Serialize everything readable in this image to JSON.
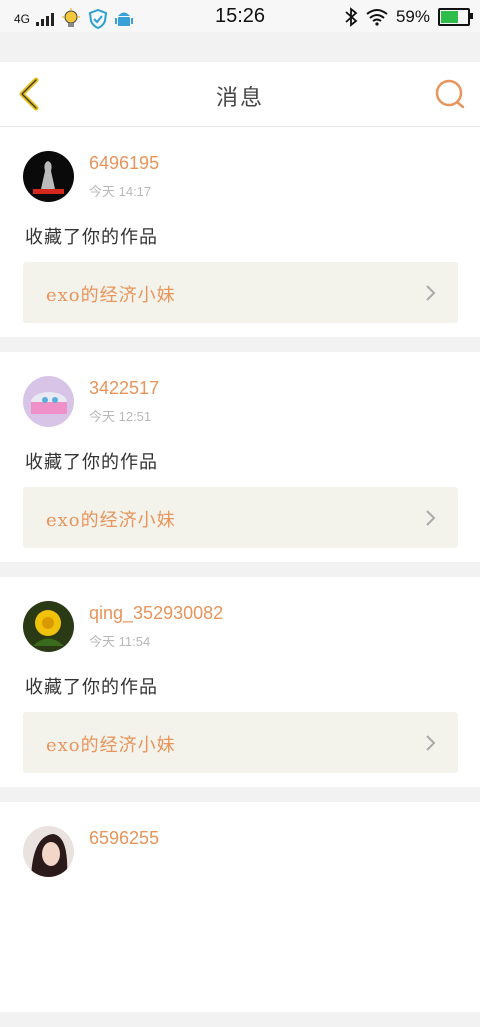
{
  "status_bar": {
    "network": "4G",
    "time": "15:26",
    "battery_percent": "59%",
    "battery_level": 0.59,
    "icons": [
      "signal-icon",
      "bulb-icon",
      "shield-icon",
      "android-icon",
      "bluetooth-icon",
      "wifi-icon",
      "battery-icon"
    ]
  },
  "header": {
    "title": "消息",
    "back_icon": "chevron-left-icon",
    "search_icon": "search-icon"
  },
  "colors": {
    "accent": "#e8945a",
    "back_arrow": "#e8c21a",
    "card_bg": "#ffffff",
    "work_bg": "#f3f3ec",
    "page_bg": "#f2f2f2"
  },
  "messages": [
    {
      "user": "6496195",
      "time": "今天 14:17",
      "action": "收藏了你的作品",
      "work": "exo的经济小妹"
    },
    {
      "user": "3422517",
      "time": "今天 12:51",
      "action": "收藏了你的作品",
      "work": "exo的经济小妹"
    },
    {
      "user": "qing_352930082",
      "time": "今天 11:54",
      "action": "收藏了你的作品",
      "work": "exo的经济小妹"
    },
    {
      "user": "6596255"
    }
  ]
}
